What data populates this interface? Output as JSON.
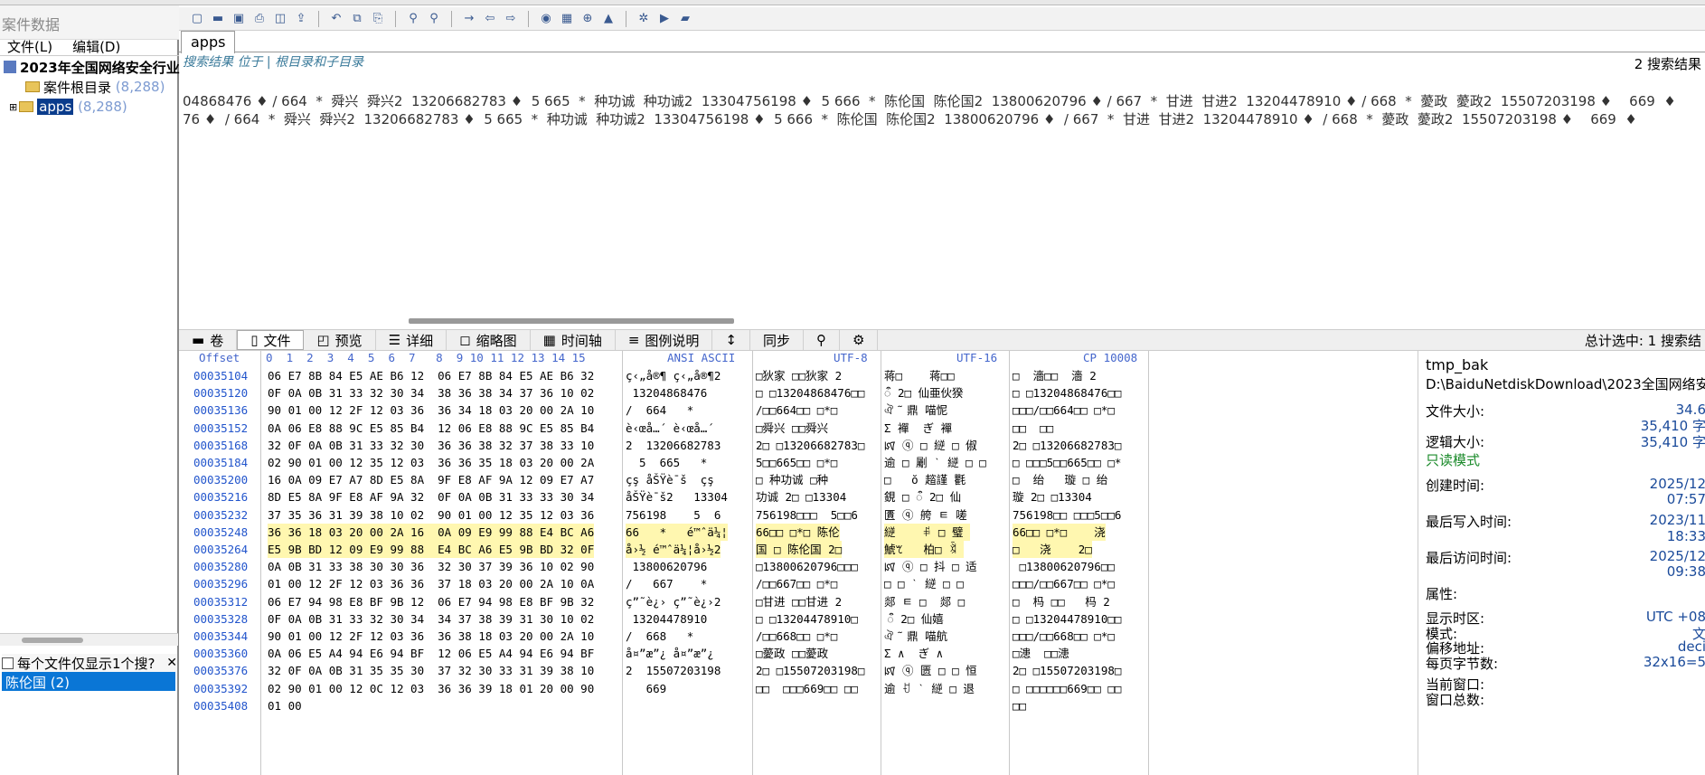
{
  "left_panel": {
    "title": "案件数据",
    "menu": [
      "文件(L)",
      "编辑(D)"
    ],
    "tree": [
      {
        "label": "2023年全国网络安全行业",
        "count": ""
      },
      {
        "label": "案件根目录",
        "count": "(8,288)"
      },
      {
        "label": "apps",
        "count": "(8,288)"
      }
    ],
    "option_label": "每个文件仅显示1个搜?",
    "result": "陈伦国 (2)"
  },
  "tab": {
    "label": "apps"
  },
  "breadcrumb": "搜索结果  位于 | 根目录和子目录",
  "results_count": "2 搜索结果",
  "search_lines": [
    "04868476 ♦ / 664  *  舜兴  舜兴2  13206682783 ♦  5 665  *  种功诚  种功诚2  13304756198 ♦  5 666  *  陈伦国  陈伦国2  13800620796 ♦ / 667  *  甘进  甘进2  13204478910 ♦ / 668  *  薆政  薆政2  15507203198 ♦    669  ♦",
    "76 ♦  / 664  *  舜兴  舜兴2  13206682783 ♦  5 665  *  种功诚  种功诚2  13304756198 ♦  5 666  *  陈伦国  陈伦国2  13800620796 ♦  / 667  *  甘进  甘进2  13204478910 ♦  / 668  *  薆政  薆政2  15507203198 ♦    669  ♦"
  ],
  "viewbar": {
    "tabs": [
      "卷",
      "文件",
      "预览",
      "详细",
      "缩略图",
      "时间轴",
      "图例说明"
    ],
    "sync": "同步",
    "sel_info": "总计选中: 1 搜索结"
  },
  "hex": {
    "headers": {
      "offset": "Offset",
      "cols": "0  1  2  3  4  5  6  7   8  9 10 11 12 13 14 15",
      "ansi": "ANSI ASCII",
      "utf8": "UTF-8",
      "utf16": "UTF-16",
      "cp": "CP 10008"
    },
    "offsets": [
      "00035104",
      "00035120",
      "00035136",
      "00035152",
      "00035168",
      "00035184",
      "00035200",
      "00035216",
      "00035232",
      "00035248",
      "00035264",
      "00035280",
      "00035296",
      "00035312",
      "00035328",
      "00035344",
      "00035360",
      "00035376",
      "00035392",
      "00035408"
    ],
    "bytes": [
      "06 E7 8B 84 E5 AE B6 12  06 E7 8B 84 E5 AE B6 32",
      "0F 0A 0B 31 33 32 30 34  38 36 38 34 37 36 10 02",
      "90 01 00 12 2F 12 03 36  36 34 18 03 20 00 2A 10",
      "0A 06 E8 88 9C E5 85 B4  12 06 E8 88 9C E5 85 B4",
      "32 0F 0A 0B 31 33 32 30  36 36 38 32 37 38 33 10",
      "02 90 01 00 12 35 12 03  36 36 35 18 03 20 00 2A",
      "16 0A 09 E7 A7 8D E5 8A  9F E8 AF 9A 12 09 E7 A7",
      "8D E5 8A 9F E8 AF 9A 32  0F 0A 0B 31 33 33 30 34",
      "37 35 36 31 39 38 10 02  90 01 00 12 35 12 03 36",
      "36 36 18 03 20 00 2A 16  0A 09 E9 99 88 E4 BC A6",
      "E5 9B BD 12 09 E9 99 88  E4 BC A6 E5 9B BD 32 0F",
      "0A 0B 31 33 38 30 30 36  32 30 37 39 36 10 02 90",
      "01 00 12 2F 12 03 36 36  37 18 03 20 00 2A 10 0A",
      "06 E7 94 98 E8 BF 9B 12  06 E7 94 98 E8 BF 9B 32",
      "0F 0A 0B 31 33 32 30 34  34 37 38 39 31 30 10 02",
      "90 01 00 12 2F 12 03 36  36 38 18 03 20 00 2A 10",
      "0A 06 E5 A4 94 E6 94 BF  12 06 E5 A4 94 E6 94 BF",
      "32 0F 0A 0B 31 35 35 30  37 32 30 33 31 39 38 10",
      "02 90 01 00 12 0C 12 03  36 36 39 18 01 20 00 90",
      "01 00"
    ],
    "ansi": [
      "ç‹„å®¶ ç‹„å®¶2",
      " 13204868476",
      "/  664   *",
      "è‹œå…´ è‹œå…´",
      "2  13206682783",
      "  5  665   *",
      "çş åŠŸè¯š  çş",
      "åŠŸè¯š2   13304",
      "756198    5  6",
      "66   *   é™ˆä¼¦",
      "å›½ é™ˆä¼¦å›½2",
      " 13800620796",
      "/   667    *",
      "ç”˜è¿› ç”˜è¿›2",
      " 13204478910",
      "/  668   *",
      "å¤”æ”¿ å¤”æ”¿",
      "2  15507203198",
      "   669",
      ""
    ],
    "utf8": [
      "□狄家 □□狄家 2",
      "□ □13204868476□□",
      "/□□664□□ □*□",
      "□舜兴 □□舜兴",
      "2□ □13206682783□",
      "5□□665□□ □*□",
      "□ 种功诚 □种",
      "功诚 2□ □13304",
      "756198□□□  5□□6",
      "66□□ □*□ 陈伦",
      "国 □ 陈伦国 2□",
      "□13800620796□□□",
      "/□□667□□ □*□",
      "□甘进 □□甘进 2",
      "□ □13204478910□",
      "/□□668□□ □*□",
      "□薆政 □□薆政",
      "2□ □15507203198□",
      "□□  □□□669□□ □□",
      ""
    ],
    "utf16": [
      "蒋□    蒋□□",
      "ऀ 2□ 仙亜伙猤 ",
      "ঐ ᷉ ⿍ 喵怩   ",
      "Σ 襌  ぎ 襌 ",
      "ꡤ ⓠ □ 縌 □ 俶 ",
      "逾 □ 劚 ˋ 縌 □ □",
      "□   ŏ 趦謹 氍 ",
      "鋧 □ ऀ 2□ 仙 ",
      "匱 ⓠ 舿 ㅌ 嗟 ",
      "縌    ꅰ □ 璧 ",
      "鯱ꕎ   柏□ ꃕ ",
      "ꡤ ⓠ □ 抖 □ 适",
      "□ □ ˋ 縌 □ □ ",
      "郯 ㅌ □  郯 □",
      " ऀ 2□ 仙嬉 ",
      "ঐ ᷉ ⿍ 喵航   ",
      "Σ ∧  ぎ ∧  ",
      "ꡤ ⓠ 匮 □ □ 恒 ",
      "逾 ꀀ ˋ 縌 □ 退",
      ""
    ],
    "cp": [
      "□  濇□□  濇 2",
      "□ □13204868476□□",
      "□□□/□□664□□ □*□",
      "□□  □□",
      "2□ □13206682783□",
      "□ □□□5□□665□□ □*",
      "□  绐   璇 □ 绐",
      "璇 2□ □13304",
      "756198□□ □□□5□□6",
      "66□□ □*□    浇",
      "□   浇    2□",
      " □13800620796□□",
      "□□□/□□667□□ □*□",
      "□  杩 □□   杩 2",
      "□ □13204478910□□",
      "□□□/□□668□□ □*□",
      "□漶  □□漶",
      "2□ □15507203198□",
      "□ □□□□□□669□□ □□",
      "□□"
    ]
  },
  "info": {
    "filename": "tmp_bak",
    "path": "D:\\BaiduNetdiskDownload\\2023全国网络安",
    "rows": [
      {
        "label": "文件大小:",
        "value": "34.6"
      },
      {
        "label": "",
        "value": "35,410 字"
      },
      {
        "label": "逻辑大小:",
        "value": "35,410 字"
      },
      {
        "label": "只读模式",
        "value": ""
      },
      {
        "label": "创建时间:",
        "value": "2025/12"
      },
      {
        "label": "",
        "value": "07:57"
      },
      {
        "label": "最后写入时间:",
        "value": "2023/11"
      },
      {
        "label": "",
        "value": "18:33"
      },
      {
        "label": "最后访问时间:",
        "value": "2025/12"
      },
      {
        "label": "",
        "value": "09:38"
      },
      {
        "label": "属性:",
        "value": ""
      },
      {
        "label": "显示时区:",
        "value": "UTC +08"
      },
      {
        "label": "模式:",
        "value": "文"
      },
      {
        "label": "偏移地址:",
        "value": "deci"
      },
      {
        "label": "每页字节数:",
        "value": "32x16=5"
      },
      {
        "label": "当前窗口:",
        "value": ""
      },
      {
        "label": "窗口总数:",
        "value": ""
      }
    ]
  }
}
